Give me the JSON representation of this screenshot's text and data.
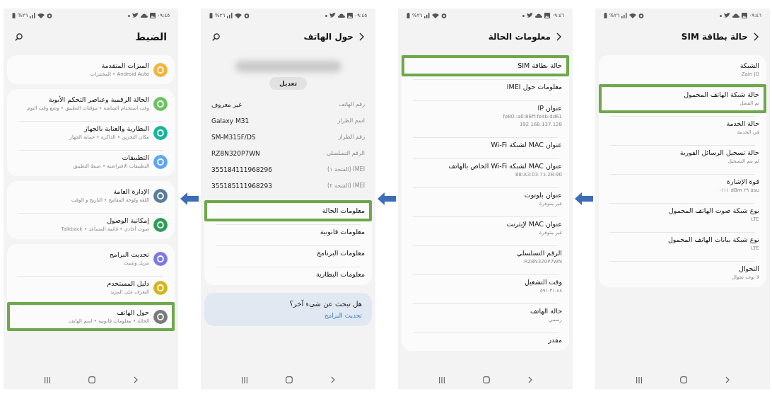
{
  "screens": [
    {
      "status_bar": {
        "battery": "%٢٦",
        "time": "٠٩:٤٦"
      },
      "header": {
        "title": "حالة بطاقة SIM",
        "back": true,
        "search": false
      },
      "groups": [
        {
          "items": [
            {
              "title": "الشبكة",
              "subtitle": "Zain JO",
              "highlighted": false
            },
            {
              "title": "حالة شبكة الهاتف المحمول",
              "subtitle": "تم الفصل",
              "highlighted": true
            },
            {
              "title": "حالة الخدمة",
              "subtitle": "في الخدمة",
              "highlighted": false
            },
            {
              "title": "حالة تسجيل الرسائل الفورية",
              "subtitle": "لم يتم التسجيل",
              "highlighted": false
            },
            {
              "title": "قوة الإشارة",
              "subtitle": "-١١١ dBm ٢٩ asu",
              "highlighted": false
            },
            {
              "title": "نوع شبكة صوت الهاتف المحمول",
              "subtitle": "LTE",
              "highlighted": false
            },
            {
              "title": "نوع شبكة بيانات الهاتف المحمول",
              "subtitle": "LTE",
              "highlighted": false
            },
            {
              "title": "التجوال",
              "subtitle": "لا يوجد تجوال",
              "highlighted": false
            }
          ]
        }
      ]
    },
    {
      "status_bar": {
        "battery": "%٢٦",
        "time": "٠٩:٤٦"
      },
      "header": {
        "title": "معلومات الحالة",
        "back": true,
        "search": false
      },
      "groups": [
        {
          "items": [
            {
              "title": "حالة بطاقة SIM",
              "highlighted": true
            },
            {
              "title": "معلومات حول IMEI",
              "highlighted": false
            },
            {
              "title": "عنوان IP",
              "subtitle": "fe80::a0:86ff:fe4b:dd61\n192.168.137.128",
              "highlighted": false
            },
            {
              "title": "عنوان MAC لشبكة Wi-Fi",
              "highlighted": false
            },
            {
              "title": "عنوان MAC لشبكة Wi-Fi الخاص بالهاتف",
              "subtitle": "88:A3:03:71:2B:90",
              "highlighted": false
            },
            {
              "title": "عنوان بلوتوث",
              "subtitle": "غير متوفرة",
              "highlighted": false
            },
            {
              "title": "عنوان MAC لإيثرنت",
              "subtitle": "غير متوفرة",
              "highlighted": false
            },
            {
              "title": "الرقم التسلسلي",
              "subtitle": "RZ8N320P7WN",
              "highlighted": false
            },
            {
              "title": "وقت التشغيل",
              "subtitle": "٥٩١:٣١:٤٨",
              "highlighted": false
            },
            {
              "title": "حالة الهاتف",
              "subtitle": "رسمي",
              "highlighted": false
            },
            {
              "title": "مقدر",
              "highlighted": false
            }
          ]
        }
      ]
    },
    {
      "status_bar": {
        "battery": "%٢٦",
        "time": "٠٩:٤٥"
      },
      "header": {
        "title": "حول الهاتف",
        "back": true,
        "search": true
      },
      "device_name": {
        "blurred": true
      },
      "edit_button": "تعديل",
      "info_rows": [
        {
          "label": "رقم الهاتف",
          "value": "غير معروف"
        },
        {
          "label": "اسم الطراز",
          "value": "Galaxy M31"
        },
        {
          "label": "رقم الطراز",
          "value": "SM-M315F/DS"
        },
        {
          "label": "الرقم التسلسلي",
          "value": "RZ8N320P7WN"
        },
        {
          "label": "IMEI (الفتحة ١)",
          "value": "355184111968296"
        },
        {
          "label": "IMEI (الفتحة ٢)",
          "value": "355185111968293"
        }
      ],
      "groups": [
        {
          "items": [
            {
              "title": "معلومات الحالة",
              "highlighted": true
            },
            {
              "title": "معلومات قانونية",
              "highlighted": false
            },
            {
              "title": "معلومات البرنامج",
              "highlighted": false
            },
            {
              "title": "معلومات البطارية",
              "highlighted": false
            }
          ]
        }
      ],
      "suggestion": {
        "question": "هل تبحث عن شيء آخر؟",
        "link": "تحديث البرامج"
      }
    },
    {
      "status_bar": {
        "battery": "%٢٦",
        "time": "٠٩:٤٥"
      },
      "header": {
        "title": "الضبط",
        "back": false,
        "search": true
      },
      "groups": [
        {
          "items": [
            {
              "title": "الميزات المتقدمة",
              "subtitle": "Android Auto • المختبرات",
              "color": "#f4b43e",
              "highlighted": false
            }
          ]
        },
        {
          "items": [
            {
              "title": "الحالة الرقمية وعناصر التحكم الأبوية",
              "subtitle": "وقت استخدام الشاشة • مؤقتات التطبيق • وضع وقت النوم",
              "color": "#6cc25f",
              "highlighted": false
            },
            {
              "title": "البطارية والعناية بالجهاز",
              "subtitle": "مكان التخزين • الذاكرة • حماية الجهاز",
              "color": "#19b596",
              "highlighted": false
            },
            {
              "title": "التطبيقات",
              "subtitle": "التطبيقات الافتراضية • ضبط التطبيق",
              "color": "#5ea6f2",
              "highlighted": false
            }
          ]
        },
        {
          "items": [
            {
              "title": "الإدارة العامة",
              "subtitle": "اللغة ولوحة المفاتيح • التاريخ و الوقت",
              "color": "#5a7d99",
              "highlighted": false
            },
            {
              "title": "إمكانية الوصول",
              "subtitle": "صوت أحادي • قائمة المساعد • Talkback",
              "color": "#2f9d58",
              "highlighted": false
            }
          ]
        },
        {
          "items": [
            {
              "title": "تحديث البرامج",
              "subtitle": "تنزيل وتثبيت",
              "color": "#7d78e2",
              "highlighted": false
            },
            {
              "title": "دليل المستخدم",
              "subtitle": "التعرف على المزيد",
              "color": "#d4b51c",
              "highlighted": false
            },
            {
              "title": "حول الهاتف",
              "subtitle": "الحالة • معلومات قانونية • اسم الهاتف",
              "color": "#7a7a7a",
              "highlighted": true
            }
          ]
        }
      ]
    }
  ]
}
